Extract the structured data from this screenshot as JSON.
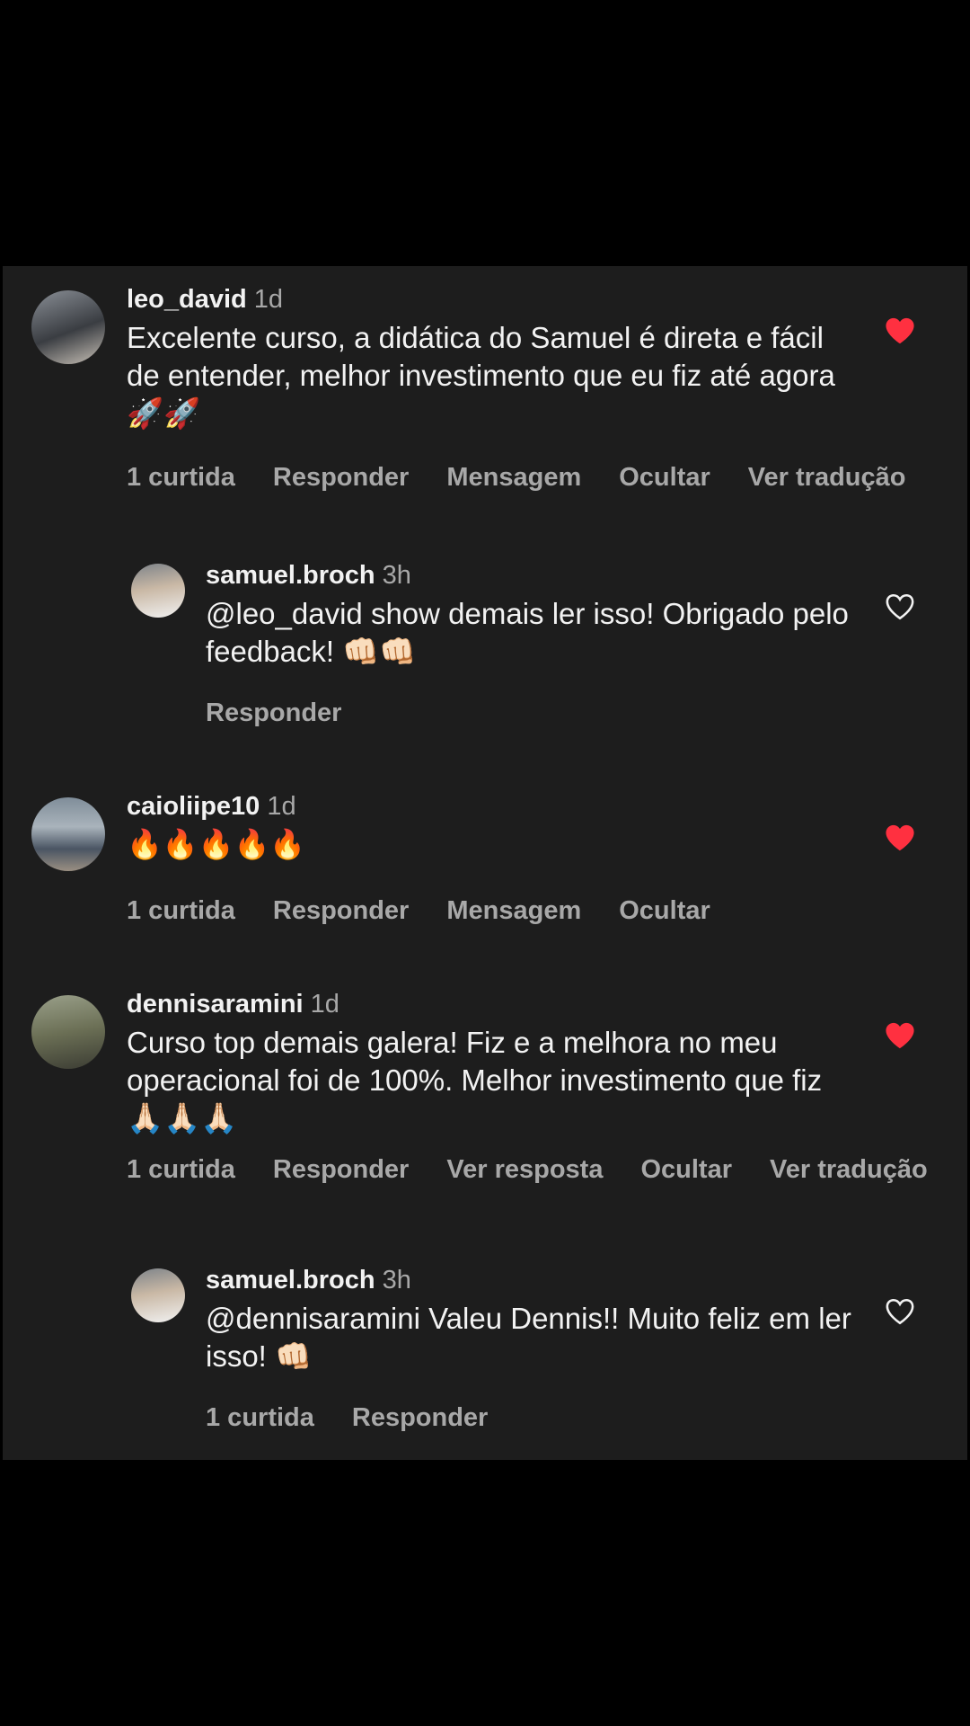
{
  "comments": [
    {
      "username": "leo_david",
      "time": "1d",
      "text": "Excelente curso, a didática do Samuel é direta e fácil de entender, melhor investimento que eu fiz até agora 🚀🚀",
      "actions": [
        "1 curtida",
        "Responder",
        "Mensagem",
        "Ocultar",
        "Ver tradução"
      ],
      "liked": true,
      "reply": {
        "username": "samuel.broch",
        "time": "3h",
        "text": "@leo_david show demais ler isso! Obrigado pelo feedback! 👊🏻👊🏻",
        "actions": [
          "Responder"
        ],
        "liked": false
      }
    },
    {
      "username": "caioliipe10",
      "time": "1d",
      "text": "🔥🔥🔥🔥🔥",
      "actions": [
        "1 curtida",
        "Responder",
        "Mensagem",
        "Ocultar"
      ],
      "liked": true
    },
    {
      "username": "dennisaramini",
      "time": "1d",
      "text": "Curso top demais galera! Fiz e a melhora no meu operacional foi de 100%. Melhor investimento que fiz 🙏🏻🙏🏻🙏🏻",
      "actions": [
        "1 curtida",
        "Responder",
        "Ver resposta",
        "Ocultar",
        "Ver tradução"
      ],
      "liked": true,
      "reply": {
        "username": "samuel.broch",
        "time": "3h",
        "text": "@dennisaramini Valeu Dennis!! Muito feliz em ler isso! 👊🏻",
        "actions": [
          "1 curtida",
          "Responder"
        ],
        "liked": false
      }
    }
  ],
  "colors": {
    "background": "#1d1d1d",
    "text": "#f2f2f2",
    "muted": "#a8a8a8",
    "like": "#ff3040"
  },
  "icons": [
    "heart-filled-icon",
    "heart-outline-icon"
  ]
}
